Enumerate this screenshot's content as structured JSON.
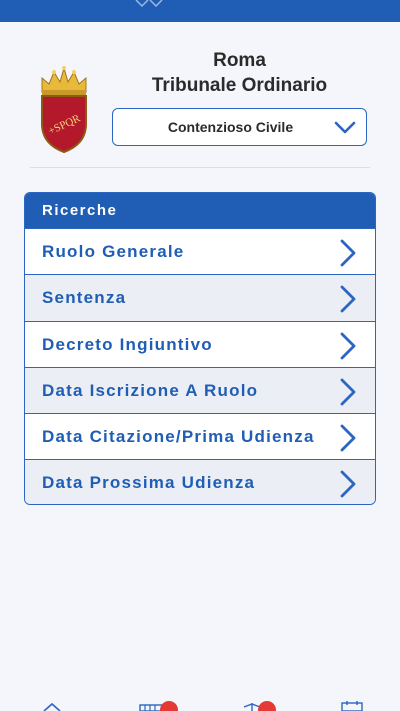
{
  "header": {
    "city": "Roma",
    "court": "Tribunale Ordinario",
    "section_select": {
      "value": "Contenzioso Civile"
    }
  },
  "searches": {
    "title": "Ricerche",
    "items": [
      {
        "label": "Ruolo Generale"
      },
      {
        "label": "Sentenza"
      },
      {
        "label": "Decreto Ingiuntivo"
      },
      {
        "label": "Data Iscrizione A Ruolo"
      },
      {
        "label": "Data Citazione/Prima Udienza"
      },
      {
        "label": "Data Prossima Udienza"
      }
    ]
  },
  "tabbar": {
    "tabs": [
      {
        "icon": "home-icon"
      },
      {
        "icon": "courthouse-icon",
        "badge_color": "#e53935"
      },
      {
        "icon": "scales-icon",
        "badge_color": "#e53935"
      },
      {
        "icon": "calendar-icon"
      }
    ]
  },
  "colors": {
    "primary": "#1f5eb4",
    "accent_border": "#2a66c2",
    "background": "#f4f6fb",
    "row_alt": "#ebeef5",
    "badge": "#e53935"
  }
}
